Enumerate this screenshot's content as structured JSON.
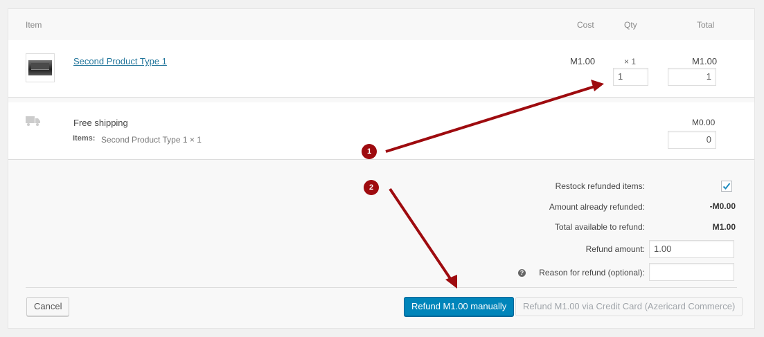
{
  "headers": {
    "item": "Item",
    "cost": "Cost",
    "qty": "Qty",
    "total": "Total"
  },
  "product": {
    "name": "Second Product Type 1",
    "cost": "M1.00",
    "qty_display": "× 1",
    "total": "M1.00",
    "refund_qty": "1",
    "refund_total": "1"
  },
  "shipping": {
    "name": "Free shipping",
    "items_label": "Items:",
    "items_value": "Second Product Type 1 × 1",
    "total": "M0.00",
    "refund_total": "0"
  },
  "refund": {
    "restock_label": "Restock refunded items:",
    "restock_checked": true,
    "already_label": "Amount already refunded:",
    "already_value": "-M0.00",
    "available_label": "Total available to refund:",
    "available_value": "M1.00",
    "amount_label": "Refund amount:",
    "amount_value": "1.00",
    "reason_label": "Reason for refund (optional):",
    "reason_value": ""
  },
  "buttons": {
    "cancel": "Cancel",
    "manual": "Refund M1.00 manually",
    "gateway": "Refund M1.00 via Credit Card (Azericard Commerce)"
  },
  "annotations": {
    "step1": "1",
    "step2": "2"
  },
  "colors": {
    "accent": "#0085ba",
    "annotation": "#9e0b0f",
    "link": "#21759b"
  }
}
